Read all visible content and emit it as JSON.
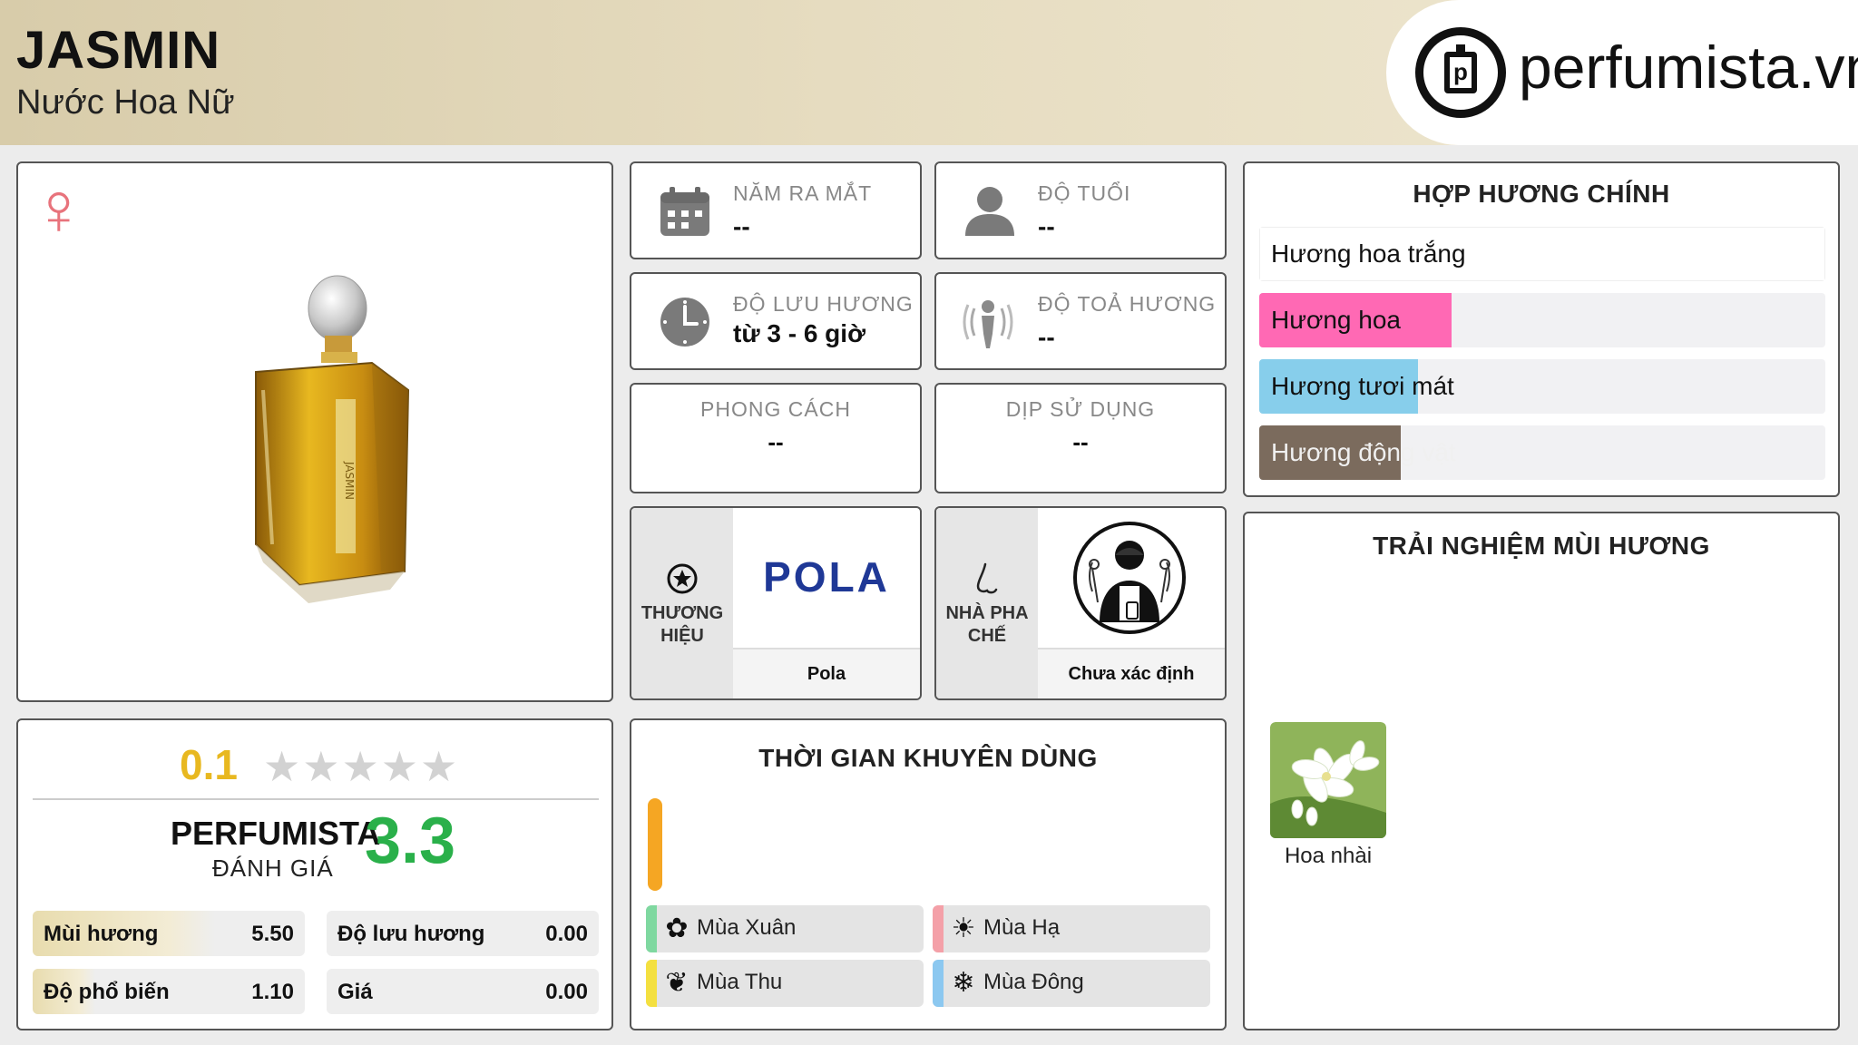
{
  "header": {
    "title": "JASMIN",
    "subtitle": "Nước Hoa Nữ",
    "logo_text": "perfumista.vn",
    "logo_mark": "p"
  },
  "product": {
    "gender_icon": "♀",
    "bottle_label": "JASMIN"
  },
  "info": {
    "release_year": {
      "label": "NĂM RA MẮT",
      "value": "--",
      "icon": "calendar-icon"
    },
    "age": {
      "label": "ĐỘ TUỔI",
      "value": "--",
      "icon": "person-icon"
    },
    "longevity": {
      "label": "ĐỘ LƯU HƯƠNG",
      "value": "từ 3 - 6 giờ",
      "icon": "clock-icon"
    },
    "sillage": {
      "label": "ĐỘ TOẢ HƯƠNG",
      "value": "--",
      "icon": "sillage-icon"
    },
    "style": {
      "label": "PHONG CÁCH",
      "value": "--"
    },
    "occasion": {
      "label": "DỊP SỬ DỤNG",
      "value": "--"
    }
  },
  "brand": {
    "label": "THƯƠNG HIỆU",
    "logo_text": "POLA",
    "name": "Pola",
    "color": "#1f3896"
  },
  "perfumer": {
    "label": "NHÀ PHA CHẾ",
    "name": "Chưa xác định"
  },
  "accords": {
    "title": "HỢP HƯƠNG CHÍNH",
    "items": [
      {
        "label": "Hương hoa trắng",
        "color": "#ffffff",
        "fill": 1.0
      },
      {
        "label": "Hương hoa",
        "color": "#ff69b4",
        "fill": 0.34
      },
      {
        "label": "Hương tươi mát",
        "color": "#87ceeb",
        "fill": 0.28
      },
      {
        "label": "Hương động vật",
        "color": "#7b6b5d",
        "fill": 0.25
      }
    ]
  },
  "rating": {
    "user_score": "0.1",
    "stars": "★★★★★",
    "perfumista_label": "PERFUMISTA",
    "perfumista_sub": "ĐÁNH GIÁ",
    "perfumista_score": "3.3",
    "scores": [
      {
        "label": "Mùi hương",
        "value": "5.50",
        "fill": 0.55
      },
      {
        "label": "Độ lưu hương",
        "value": "0.00",
        "fill": 0.0
      },
      {
        "label": "Độ phổ biến",
        "value": "1.10",
        "fill": 0.11
      },
      {
        "label": "Giá",
        "value": "0.00",
        "fill": 0.0
      }
    ]
  },
  "time": {
    "title": "THỜI GIAN KHUYÊN DÙNG",
    "day_night_color": "#f5a623",
    "seasons": [
      {
        "label": "Mùa Xuân",
        "color": "#7fd8a0",
        "icon": "flower-icon"
      },
      {
        "label": "Mùa Hạ",
        "color": "#f4a0a8",
        "icon": "sun-icon"
      },
      {
        "label": "Mùa Thu",
        "color": "#f4e040",
        "icon": "leaf-icon"
      },
      {
        "label": "Mùa Đông",
        "color": "#8cc8f0",
        "icon": "snowflake-icon"
      }
    ]
  },
  "experience": {
    "title": "TRẢI NGHIỆM MÙI HƯƠNG",
    "notes": [
      {
        "label": "Hoa nhài",
        "icon": "jasmine-flower-icon"
      }
    ]
  }
}
